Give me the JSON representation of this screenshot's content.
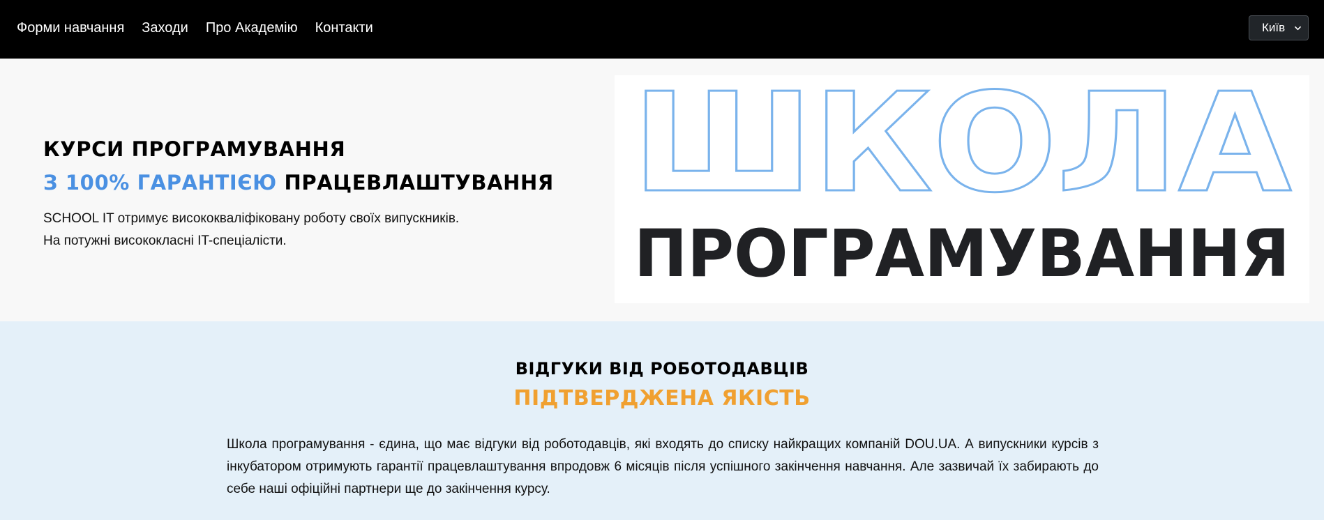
{
  "nav": {
    "items": [
      {
        "label": "Форми навчання"
      },
      {
        "label": "Заходи"
      },
      {
        "label": "Про Академію"
      },
      {
        "label": "Контакти"
      }
    ],
    "city": "Київ"
  },
  "hero": {
    "title_line1": "КУРСИ ПРОГРАМУВАННЯ",
    "title_accent": "З 100% ГАРАНТІЄЮ",
    "title_rest": " ПРАЦЕВЛАШТУВАННЯ",
    "text_line1": "SCHOOL IT отримує висококваліфіковану роботу своїх випускників.",
    "text_line2": "На потужні висококласні IT-спеціалісти.",
    "logo": {
      "word_top": "ШКОЛА",
      "word_bottom": "ПРОГРАМУВАННЯ",
      "outline_color": "#7ab3ec",
      "bottom_color": "#202124"
    }
  },
  "reviews": {
    "title": "ВІДГУКИ ВІД РОБОТОДАВЦІВ",
    "subtitle": "ПІДТВЕРДЖЕНА ЯКІСТЬ",
    "text": "Школа програмування - єдина, що має відгуки від роботодавців, які входять до списку найкращих компаній DOU.UA. А випускники курсів з інкубатором отримують гарантії працевлаштування впродовж 6 місяців після успішного закінчення навчання. Але зазвичай їх забирають до себе наші офіційні партнери ще до закінчення курсу."
  },
  "colors": {
    "accent_blue": "#4a90e2",
    "accent_orange": "#f0a030",
    "header_bg": "#000000",
    "reviews_bg": "#e4f0f9"
  }
}
